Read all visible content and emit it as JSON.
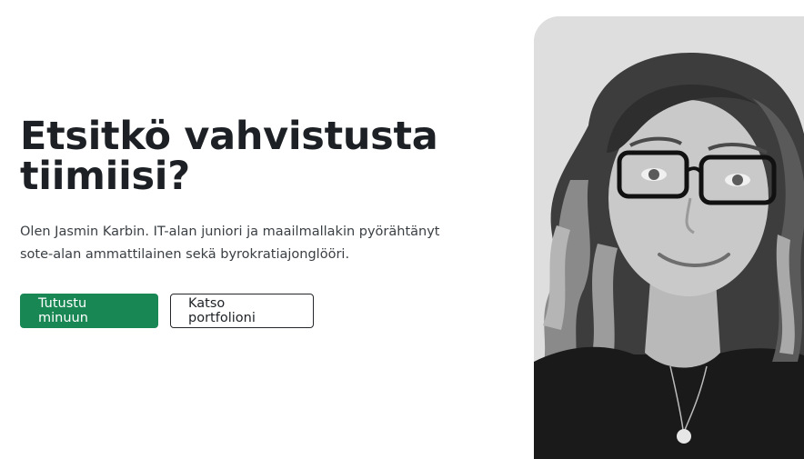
{
  "hero": {
    "title": "Etsitkö vahvistusta tiimiisi?",
    "lead": "Olen Jasmin Karbin. IT-alan juniori ja maailmallakin pyörähtänyt sote-alan ammattilainen sekä byrokratiajonglööri."
  },
  "actions": {
    "primary_label": "Tutustu minuun",
    "secondary_label": "Katso portfolioni"
  },
  "colors": {
    "primary": "#198754",
    "heading": "#1d2125",
    "body_text": "#3a3f44",
    "photo_background": "#dcdcdc"
  }
}
